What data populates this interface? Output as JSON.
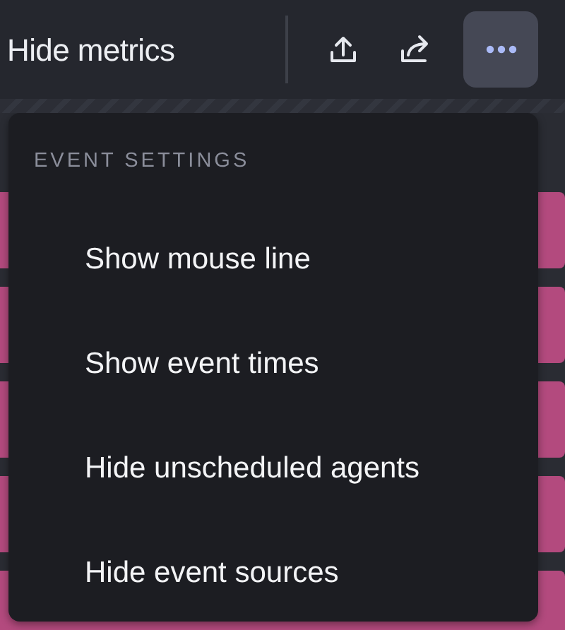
{
  "toolbar": {
    "label": "Hide metrics"
  },
  "menu": {
    "heading": "EVENT SETTINGS",
    "items": [
      {
        "label": "Show mouse line"
      },
      {
        "label": "Show event times"
      },
      {
        "label": "Hide unscheduled agents"
      },
      {
        "label": "Hide event sources"
      }
    ]
  }
}
